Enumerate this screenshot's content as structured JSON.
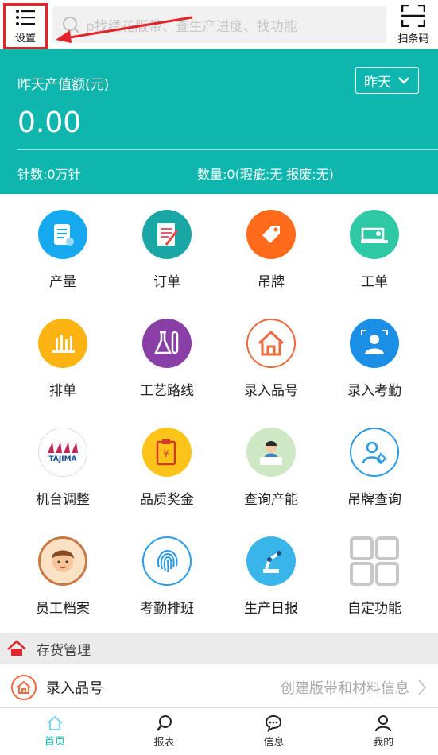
{
  "topbar": {
    "settings_label": "设置",
    "search_placeholder": "p找绣花版带、查生产进度、找功能",
    "scan_label": "扫条码"
  },
  "banner": {
    "title": "昨天产值额(元)",
    "value": "0.00",
    "day_selector": "昨天",
    "stitch_count": "针数:0万针",
    "quantity": "数量:0(瑕疵:无 报废:无)"
  },
  "grid": [
    {
      "label": "产量",
      "icon": "production-icon",
      "color": "#17a9f0"
    },
    {
      "label": "订单",
      "icon": "order-icon",
      "color": "#1aa6a4"
    },
    {
      "label": "吊牌",
      "icon": "tag-icon",
      "color": "#ff6a1b"
    },
    {
      "label": "工单",
      "icon": "sewing-machine-icon",
      "color": "#2fc8a5"
    },
    {
      "label": "排单",
      "icon": "schedule-icon",
      "color": "#fbb411"
    },
    {
      "label": "工艺路线",
      "icon": "process-route-icon",
      "color": "#8a3fa6"
    },
    {
      "label": "录入品号",
      "icon": "house-icon",
      "color": "#ffffff"
    },
    {
      "label": "录入考勤",
      "icon": "attendance-icon",
      "color": "#1b8ee6"
    },
    {
      "label": "机台调整",
      "icon": "tajima-machine-icon",
      "color": "#ffffff"
    },
    {
      "label": "品质奖金",
      "icon": "quality-bonus-icon",
      "color": "#fcc419"
    },
    {
      "label": "查询产能",
      "icon": "capacity-query-icon",
      "color": "#cfe8c4"
    },
    {
      "label": "吊牌查询",
      "icon": "tag-search-icon",
      "color": "#ffffff"
    },
    {
      "label": "员工档案",
      "icon": "employee-avatar-icon",
      "color": "#fbe2c4"
    },
    {
      "label": "考勤排班",
      "icon": "fingerprint-icon",
      "color": "#ffffff"
    },
    {
      "label": "生产日报",
      "icon": "robot-arm-icon",
      "color": "#3ab5e9"
    },
    {
      "label": "自定功能",
      "icon": "custom-grid-icon",
      "color": "#ffffff"
    }
  ],
  "tajima_text": "TAJIMA",
  "section": {
    "title": "存货管理"
  },
  "list_row": {
    "title": "录入品号",
    "description": "创建版带和材料信息"
  },
  "bottom_nav": [
    {
      "label": "首页",
      "icon": "home-icon",
      "active": true
    },
    {
      "label": "报表",
      "icon": "search-report-icon",
      "active": false
    },
    {
      "label": "信息",
      "icon": "message-icon",
      "active": false
    },
    {
      "label": "我的",
      "icon": "user-icon",
      "active": false
    }
  ],
  "colors": {
    "teal": "#0eb6ad",
    "highlight_red": "#e4242b"
  }
}
